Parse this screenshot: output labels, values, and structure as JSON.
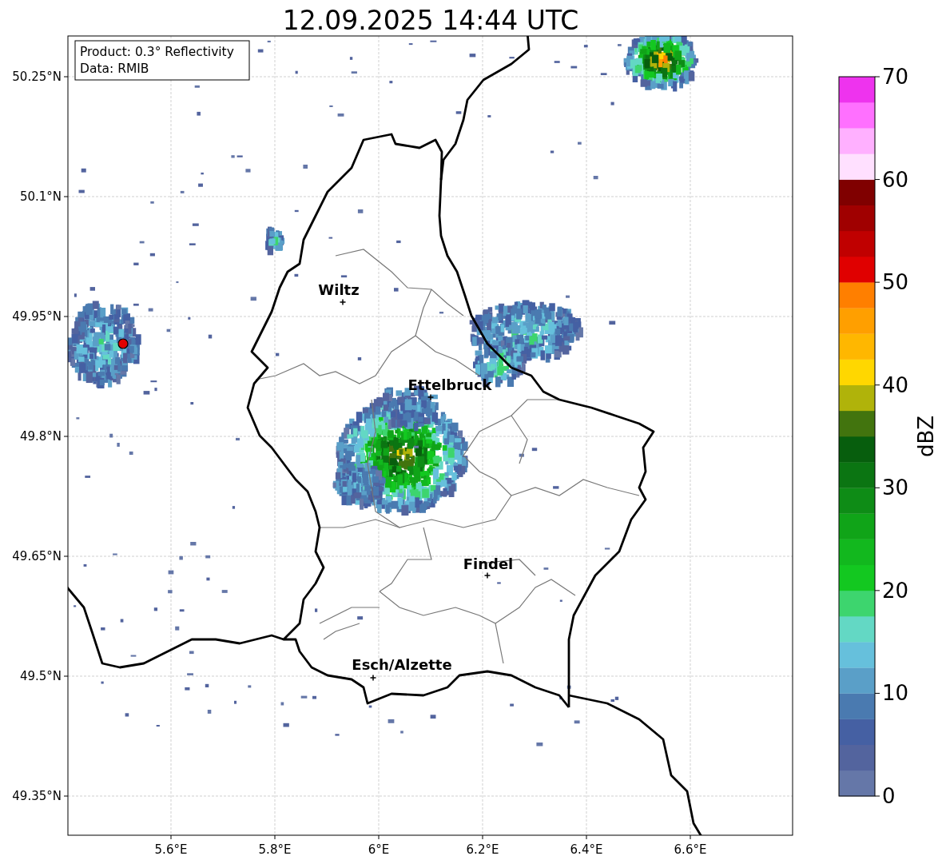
{
  "title": "12.09.2025 14:44 UTC",
  "info_box": {
    "lines": [
      "Product: 0.3° Reflectivity",
      "Data: RMIB"
    ]
  },
  "x_ticks": [
    "5.6°E",
    "5.8°E",
    "6°E",
    "6.2°E",
    "6.4°E",
    "6.6°E"
  ],
  "y_ticks": [
    "50.25°N",
    "50.1°N",
    "49.95°N",
    "49.8°N",
    "49.65°N",
    "49.5°N",
    "49.35°N"
  ],
  "cities": [
    {
      "name": "Wiltz"
    },
    {
      "name": "Ettelbruck"
    },
    {
      "name": "Findel"
    },
    {
      "name": "Esch/Alzette"
    }
  ],
  "colorbar": {
    "label": "dBZ",
    "ticks": [
      "70",
      "60",
      "50",
      "40",
      "30",
      "20",
      "10",
      "0"
    ],
    "bins": [
      {
        "color": "#6577a8"
      },
      {
        "color": "#53649e"
      },
      {
        "color": "#4560a3"
      },
      {
        "color": "#4a7ab0"
      },
      {
        "color": "#5a9fc8"
      },
      {
        "color": "#66c0dc"
      },
      {
        "color": "#63d8c4"
      },
      {
        "color": "#3dd56e"
      },
      {
        "color": "#13c820"
      },
      {
        "color": "#12b81e"
      },
      {
        "color": "#10a418"
      },
      {
        "color": "#0e8c16"
      },
      {
        "color": "#0b7512"
      },
      {
        "color": "#075e0d"
      },
      {
        "color": "#42740e"
      },
      {
        "color": "#b0b30a"
      },
      {
        "color": "#ffd700"
      },
      {
        "color": "#ffb700"
      },
      {
        "color": "#ff9f00"
      },
      {
        "color": "#ff7f00"
      },
      {
        "color": "#e00000"
      },
      {
        "color": "#c00000"
      },
      {
        "color": "#a00000"
      },
      {
        "color": "#800000"
      },
      {
        "color": "#ffe0ff"
      },
      {
        "color": "#ffb0ff"
      },
      {
        "color": "#ff70ff"
      },
      {
        "color": "#ee33ee"
      }
    ]
  }
}
